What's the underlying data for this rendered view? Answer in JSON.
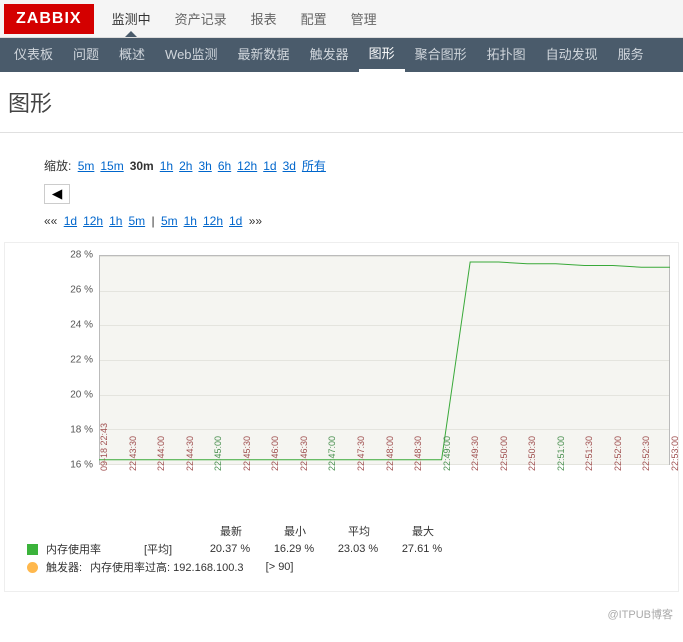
{
  "logo": "ZABBIX",
  "top_nav": [
    "监测中",
    "资产记录",
    "报表",
    "配置",
    "管理"
  ],
  "top_nav_active": 0,
  "sub_nav": [
    "仪表板",
    "问题",
    "概述",
    "Web监测",
    "最新数据",
    "触发器",
    "图形",
    "聚合图形",
    "拓扑图",
    "自动发现",
    "服务"
  ],
  "sub_nav_active": 6,
  "page_title": "图形",
  "zoom": {
    "label": "缩放:",
    "opts": [
      "5m",
      "15m",
      "30m",
      "1h",
      "2h",
      "3h",
      "6h",
      "12h",
      "1d",
      "3d",
      "所有"
    ],
    "sel": 2
  },
  "timebar": {
    "prefix": "««",
    "left": [
      "1d",
      "12h",
      "1h",
      "5m"
    ],
    "sep": "|",
    "right": [
      "5m",
      "1h",
      "12h",
      "1d"
    ],
    "suffix": "»»"
  },
  "nav_prev": "◀",
  "chart_data": {
    "type": "line",
    "ylim": [
      16,
      28
    ],
    "yticks": [
      16,
      18,
      20,
      22,
      24,
      26,
      28
    ],
    "xticks": [
      "09-18 22:43",
      "22:43:30",
      "22:44:00",
      "22:44:30",
      "22:45:00",
      "22:45:30",
      "22:46:00",
      "22:46:30",
      "22:47:00",
      "22:47:30",
      "22:48:00",
      "22:48:30",
      "22:49:00",
      "22:49:30",
      "22:50:00",
      "22:50:30",
      "22:51:00",
      "22:51:30",
      "22:52:00",
      "22:52:30",
      "22:53:00"
    ],
    "green_ticks": [
      4,
      8,
      12,
      16
    ],
    "series": [
      {
        "name": "内存使用率",
        "color": "#39a939",
        "x": [
          0,
          1,
          2,
          3,
          4,
          5,
          6,
          7,
          8,
          9,
          10,
          11,
          12,
          13,
          14,
          15,
          16,
          17,
          18,
          19,
          20
        ],
        "y": [
          16.3,
          16.3,
          16.3,
          16.3,
          16.3,
          16.3,
          16.3,
          16.3,
          16.3,
          16.3,
          16.3,
          16.3,
          16.3,
          27.6,
          27.6,
          27.5,
          27.5,
          27.4,
          27.4,
          27.3,
          27.3
        ]
      }
    ]
  },
  "legend": {
    "item_name": "内存使用率",
    "agg": "[平均]",
    "stats_head": [
      "最新",
      "最小",
      "平均",
      "最大"
    ],
    "stats_val": [
      "20.37 %",
      "16.29 %",
      "23.03 %",
      "27.61 %"
    ],
    "trigger_label": "触发器:",
    "trigger_text": "内存使用率过高: 192.168.100.3",
    "trigger_cond": "[> 90]"
  },
  "watermark": "@ITPUB博客"
}
